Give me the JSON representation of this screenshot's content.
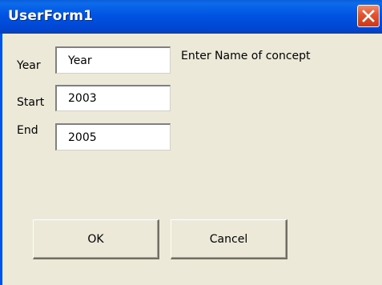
{
  "window": {
    "title": "UserForm1",
    "close_icon": "close-icon"
  },
  "form": {
    "year": {
      "label": "Year",
      "value": "Year"
    },
    "start": {
      "label": "Start",
      "value": "2003"
    },
    "end": {
      "label": "End",
      "value": "2005"
    },
    "concept_label": "Enter Name of concept"
  },
  "buttons": {
    "ok_label": "OK",
    "cancel_label": "Cancel"
  },
  "colors": {
    "titlebar": "#0054e3",
    "client_background": "#ece9d8",
    "close_button": "#e2532e"
  }
}
